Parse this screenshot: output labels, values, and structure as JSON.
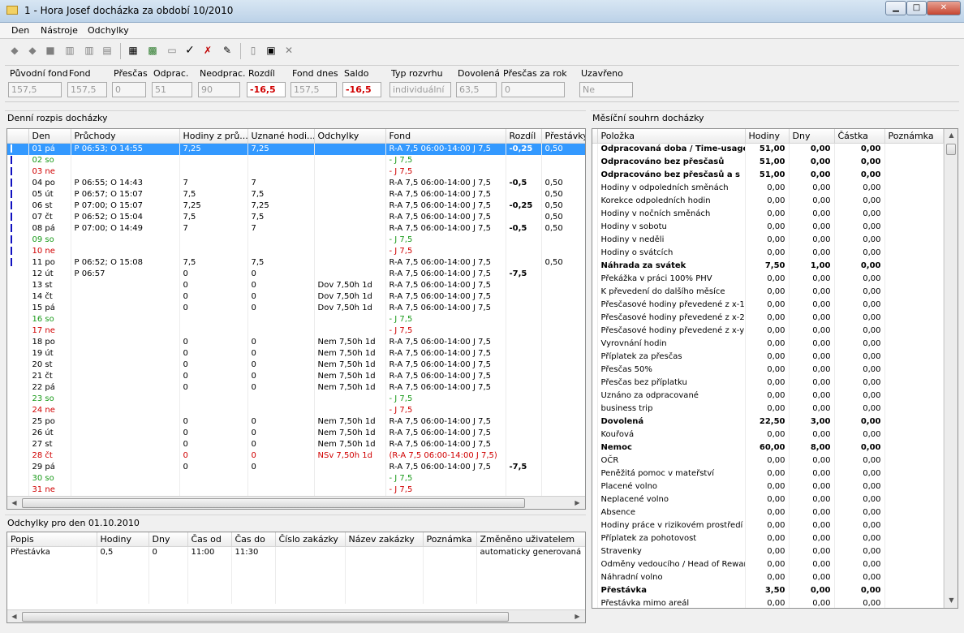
{
  "window": {
    "title": "1 - Hora Josef docházka za období 10/2010",
    "min": "▁",
    "max": "□",
    "close": "✕"
  },
  "menu": [
    "Den",
    "Nástroje",
    "Odchylky"
  ],
  "toolbar_icons": [
    "prev-record-icon",
    "next-record-icon",
    "stop-icon",
    "barcode-icon",
    "barcode-edit-icon",
    "chart-icon",
    "calculator-icon",
    "colored-grid-icon",
    "document-icon",
    "check-icon",
    "cross-check-icon",
    "sign-off-icon",
    "new-page-icon",
    "window-icon",
    "close-icon"
  ],
  "fields": [
    {
      "label": "Původní fond",
      "value": "157,5",
      "red": false
    },
    {
      "label": "Fond",
      "value": "157,5",
      "red": false
    },
    {
      "label": "Přesčas",
      "value": "0",
      "red": false
    },
    {
      "label": "Odprac.",
      "value": "51",
      "red": false
    },
    {
      "label": "Neodprac.",
      "value": "90",
      "red": false
    },
    {
      "label": "Rozdíl",
      "value": "-16,5",
      "red": true
    },
    {
      "label": "Fond dnes",
      "value": "157,5",
      "red": false
    },
    {
      "label": "Saldo",
      "value": "-16,5",
      "red": true
    },
    {
      "label": "Typ rozvrhu",
      "value": "individuální",
      "red": false
    },
    {
      "label": "Dovolená",
      "value": "63,5",
      "red": false
    },
    {
      "label": "Přesčas za rok",
      "value": "0",
      "red": false
    },
    {
      "label": "Uzavřeno",
      "value": "Ne",
      "red": false
    }
  ],
  "daily": {
    "title": "Denní rozpis docházky",
    "columns": [
      "",
      "Den",
      "Průchody",
      "Hodiny z prů...",
      "Uznané hodi...",
      "Odchylky",
      "Fond",
      "Rozdíl",
      "Přestávky"
    ],
    "rows": [
      {
        "mark": true,
        "den": "01 pá",
        "pruchody": "P 06:53; O 14:55",
        "hod": "7,25",
        "uzn": "7,25",
        "odch": "",
        "fond": "R-A  7,5  06:00-14:00 J 7,5",
        "rozdil": "-0,25",
        "prest": "0,50",
        "style": "sel"
      },
      {
        "mark": true,
        "den": "02 so",
        "pruchody": "",
        "hod": "",
        "uzn": "",
        "odch": "",
        "fond": "- J 7,5",
        "rozdil": "",
        "prest": "",
        "style": "green"
      },
      {
        "mark": true,
        "den": "03 ne",
        "pruchody": "",
        "hod": "",
        "uzn": "",
        "odch": "",
        "fond": "- J 7,5",
        "rozdil": "",
        "prest": "",
        "style": "red"
      },
      {
        "mark": true,
        "den": "04 po",
        "pruchody": "P 06:55; O 14:43",
        "hod": "7",
        "uzn": "7",
        "odch": "",
        "fond": "R-A  7,5  06:00-14:00 J 7,5",
        "rozdil": "-0,5",
        "prest": "0,50",
        "style": ""
      },
      {
        "mark": true,
        "den": "05 út",
        "pruchody": "P 06:57; O 15:07",
        "hod": "7,5",
        "uzn": "7,5",
        "odch": "",
        "fond": "R-A  7,5  06:00-14:00 J 7,5",
        "rozdil": "",
        "prest": "0,50",
        "style": ""
      },
      {
        "mark": true,
        "den": "06 st",
        "pruchody": "P 07:00; O 15:07",
        "hod": "7,25",
        "uzn": "7,25",
        "odch": "",
        "fond": "R-A  7,5  06:00-14:00 J 7,5",
        "rozdil": "-0,25",
        "prest": "0,50",
        "style": ""
      },
      {
        "mark": true,
        "den": "07 čt",
        "pruchody": "P 06:52; O 15:04",
        "hod": "7,5",
        "uzn": "7,5",
        "odch": "",
        "fond": "R-A  7,5  06:00-14:00 J 7,5",
        "rozdil": "",
        "prest": "0,50",
        "style": ""
      },
      {
        "mark": true,
        "den": "08 pá",
        "pruchody": "P 07:00; O 14:49",
        "hod": "7",
        "uzn": "7",
        "odch": "",
        "fond": "R-A  7,5  06:00-14:00 J 7,5",
        "rozdil": "-0,5",
        "prest": "0,50",
        "style": ""
      },
      {
        "mark": true,
        "den": "09 so",
        "pruchody": "",
        "hod": "",
        "uzn": "",
        "odch": "",
        "fond": "- J 7,5",
        "rozdil": "",
        "prest": "",
        "style": "green"
      },
      {
        "mark": true,
        "den": "10 ne",
        "pruchody": "",
        "hod": "",
        "uzn": "",
        "odch": "",
        "fond": "- J 7,5",
        "rozdil": "",
        "prest": "",
        "style": "red"
      },
      {
        "mark": true,
        "den": "11 po",
        "pruchody": "P 06:52; O 15:08",
        "hod": "7,5",
        "uzn": "7,5",
        "odch": "",
        "fond": "R-A  7,5  06:00-14:00 J 7,5",
        "rozdil": "",
        "prest": "0,50",
        "style": ""
      },
      {
        "mark": false,
        "den": "12 út",
        "pruchody": "P 06:57",
        "hod": "0",
        "uzn": "0",
        "odch": "",
        "fond": "R-A  7,5  06:00-14:00 J 7,5",
        "rozdil": "-7,5",
        "prest": "",
        "style": ""
      },
      {
        "mark": false,
        "den": "13 st",
        "pruchody": "",
        "hod": "0",
        "uzn": "0",
        "odch": "Dov 7,50h 1d",
        "fond": "R-A  7,5  06:00-14:00 J 7,5",
        "rozdil": "",
        "prest": "",
        "style": ""
      },
      {
        "mark": false,
        "den": "14 čt",
        "pruchody": "",
        "hod": "0",
        "uzn": "0",
        "odch": "Dov 7,50h 1d",
        "fond": "R-A  7,5  06:00-14:00 J 7,5",
        "rozdil": "",
        "prest": "",
        "style": ""
      },
      {
        "mark": false,
        "den": "15 pá",
        "pruchody": "",
        "hod": "0",
        "uzn": "0",
        "odch": "Dov 7,50h 1d",
        "fond": "R-A  7,5  06:00-14:00 J 7,5",
        "rozdil": "",
        "prest": "",
        "style": ""
      },
      {
        "mark": false,
        "den": "16 so",
        "pruchody": "",
        "hod": "",
        "uzn": "",
        "odch": "",
        "fond": "- J 7,5",
        "rozdil": "",
        "prest": "",
        "style": "green"
      },
      {
        "mark": false,
        "den": "17 ne",
        "pruchody": "",
        "hod": "",
        "uzn": "",
        "odch": "",
        "fond": "- J 7,5",
        "rozdil": "",
        "prest": "",
        "style": "red"
      },
      {
        "mark": false,
        "den": "18 po",
        "pruchody": "",
        "hod": "0",
        "uzn": "0",
        "odch": "Nem 7,50h 1d",
        "fond": "R-A  7,5  06:00-14:00 J 7,5",
        "rozdil": "",
        "prest": "",
        "style": ""
      },
      {
        "mark": false,
        "den": "19 út",
        "pruchody": "",
        "hod": "0",
        "uzn": "0",
        "odch": "Nem 7,50h 1d",
        "fond": "R-A  7,5  06:00-14:00 J 7,5",
        "rozdil": "",
        "prest": "",
        "style": ""
      },
      {
        "mark": false,
        "den": "20 st",
        "pruchody": "",
        "hod": "0",
        "uzn": "0",
        "odch": "Nem 7,50h 1d",
        "fond": "R-A  7,5  06:00-14:00 J 7,5",
        "rozdil": "",
        "prest": "",
        "style": ""
      },
      {
        "mark": false,
        "den": "21 čt",
        "pruchody": "",
        "hod": "0",
        "uzn": "0",
        "odch": "Nem 7,50h 1d",
        "fond": "R-A  7,5  06:00-14:00 J 7,5",
        "rozdil": "",
        "prest": "",
        "style": ""
      },
      {
        "mark": false,
        "den": "22 pá",
        "pruchody": "",
        "hod": "0",
        "uzn": "0",
        "odch": "Nem 7,50h 1d",
        "fond": "R-A  7,5  06:00-14:00 J 7,5",
        "rozdil": "",
        "prest": "",
        "style": ""
      },
      {
        "mark": false,
        "den": "23 so",
        "pruchody": "",
        "hod": "",
        "uzn": "",
        "odch": "",
        "fond": "- J 7,5",
        "rozdil": "",
        "prest": "",
        "style": "green"
      },
      {
        "mark": false,
        "den": "24 ne",
        "pruchody": "",
        "hod": "",
        "uzn": "",
        "odch": "",
        "fond": "- J 7,5",
        "rozdil": "",
        "prest": "",
        "style": "red"
      },
      {
        "mark": false,
        "den": "25 po",
        "pruchody": "",
        "hod": "0",
        "uzn": "0",
        "odch": "Nem 7,50h 1d",
        "fond": "R-A  7,5  06:00-14:00 J 7,5",
        "rozdil": "",
        "prest": "",
        "style": ""
      },
      {
        "mark": false,
        "den": "26 út",
        "pruchody": "",
        "hod": "0",
        "uzn": "0",
        "odch": "Nem 7,50h 1d",
        "fond": "R-A  7,5  06:00-14:00 J 7,5",
        "rozdil": "",
        "prest": "",
        "style": ""
      },
      {
        "mark": false,
        "den": "27 st",
        "pruchody": "",
        "hod": "0",
        "uzn": "0",
        "odch": "Nem 7,50h 1d",
        "fond": "R-A  7,5  06:00-14:00 J 7,5",
        "rozdil": "",
        "prest": "",
        "style": ""
      },
      {
        "mark": false,
        "den": "28 čt",
        "pruchody": "",
        "hod": "0",
        "uzn": "0",
        "odch": "NSv 7,50h 1d",
        "fond": "(R-A  7,5  06:00-14:00 J 7,5)",
        "rozdil": "",
        "prest": "",
        "style": "red"
      },
      {
        "mark": false,
        "den": "29 pá",
        "pruchody": "",
        "hod": "0",
        "uzn": "0",
        "odch": "",
        "fond": "R-A  7,5  06:00-14:00 J 7,5",
        "rozdil": "-7,5",
        "prest": "",
        "style": ""
      },
      {
        "mark": false,
        "den": "30 so",
        "pruchody": "",
        "hod": "",
        "uzn": "",
        "odch": "",
        "fond": "- J 7,5",
        "rozdil": "",
        "prest": "",
        "style": "green"
      },
      {
        "mark": false,
        "den": "31 ne",
        "pruchody": "",
        "hod": "",
        "uzn": "",
        "odch": "",
        "fond": "- J 7,5",
        "rozdil": "",
        "prest": "",
        "style": "red"
      }
    ]
  },
  "deviations": {
    "title": "Odchylky pro den 01.10.2010",
    "columns": [
      "Popis",
      "Hodiny",
      "Dny",
      "Čas od",
      "Čas do",
      "Číslo zakázky",
      "Název zakázky",
      "Poznámka",
      "Změněno uživatelem"
    ],
    "rows": [
      [
        "Přestávka",
        "0,5",
        "0",
        "11:00",
        "11:30",
        "",
        "",
        "",
        "automaticky generovaná"
      ]
    ]
  },
  "monthly": {
    "title": "Měsíční souhrn docházky",
    "columns": [
      "Položka",
      "Hodiny",
      "Dny",
      "Částka",
      "Poznámka"
    ],
    "rows": [
      {
        "name": "Odpracovaná doba / Time-usage",
        "h": "51,00",
        "d": "0,00",
        "c": "0,00",
        "bold": true
      },
      {
        "name": "Odpracováno bez přesčasů",
        "h": "51,00",
        "d": "0,00",
        "c": "0,00",
        "bold": true
      },
      {
        "name": "Odpracováno bez přesčasů a s",
        "h": "51,00",
        "d": "0,00",
        "c": "0,00",
        "bold": true
      },
      {
        "name": "Hodiny v odpoledních směnách",
        "h": "0,00",
        "d": "0,00",
        "c": "0,00",
        "bold": false
      },
      {
        "name": "Korekce odpoledních hodin",
        "h": "0,00",
        "d": "0,00",
        "c": "0,00",
        "bold": false
      },
      {
        "name": "Hodiny v nočních směnách",
        "h": "0,00",
        "d": "0,00",
        "c": "0,00",
        "bold": false
      },
      {
        "name": "Hodiny v sobotu",
        "h": "0,00",
        "d": "0,00",
        "c": "0,00",
        "bold": false
      },
      {
        "name": "Hodiny v neděli",
        "h": "0,00",
        "d": "0,00",
        "c": "0,00",
        "bold": false
      },
      {
        "name": "Hodiny o svátcích",
        "h": "0,00",
        "d": "0,00",
        "c": "0,00",
        "bold": false
      },
      {
        "name": "Náhrada za svátek",
        "h": "7,50",
        "d": "1,00",
        "c": "0,00",
        "bold": true
      },
      {
        "name": "Překážka v práci 100% PHV",
        "h": "0,00",
        "d": "0,00",
        "c": "0,00",
        "bold": false
      },
      {
        "name": "K převedení do dalšího měsíce",
        "h": "0,00",
        "d": "0,00",
        "c": "0,00",
        "bold": false
      },
      {
        "name": "Přesčasové hodiny převedené z x-1",
        "h": "0,00",
        "d": "0,00",
        "c": "0,00",
        "bold": false
      },
      {
        "name": "Přesčasové hodiny převedené z x-2",
        "h": "0,00",
        "d": "0,00",
        "c": "0,00",
        "bold": false
      },
      {
        "name": "Přesčasové hodiny převedené z x-y",
        "h": "0,00",
        "d": "0,00",
        "c": "0,00",
        "bold": false
      },
      {
        "name": "Vyrovnání hodin",
        "h": "0,00",
        "d": "0,00",
        "c": "0,00",
        "bold": false
      },
      {
        "name": "Příplatek za přesčas",
        "h": "0,00",
        "d": "0,00",
        "c": "0,00",
        "bold": false
      },
      {
        "name": "Přesčas 50%",
        "h": "0,00",
        "d": "0,00",
        "c": "0,00",
        "bold": false
      },
      {
        "name": "Přesčas bez příplatku",
        "h": "0,00",
        "d": "0,00",
        "c": "0,00",
        "bold": false
      },
      {
        "name": "Uznáno za odpracované",
        "h": "0,00",
        "d": "0,00",
        "c": "0,00",
        "bold": false
      },
      {
        "name": "business trip",
        "h": "0,00",
        "d": "0,00",
        "c": "0,00",
        "bold": false
      },
      {
        "name": "Dovolená",
        "h": "22,50",
        "d": "3,00",
        "c": "0,00",
        "bold": true
      },
      {
        "name": "Kouřová",
        "h": "0,00",
        "d": "0,00",
        "c": "0,00",
        "bold": false
      },
      {
        "name": "Nemoc",
        "h": "60,00",
        "d": "8,00",
        "c": "0,00",
        "bold": true
      },
      {
        "name": "OČR",
        "h": "0,00",
        "d": "0,00",
        "c": "0,00",
        "bold": false
      },
      {
        "name": "Peněžitá pomoc v mateřství",
        "h": "0,00",
        "d": "0,00",
        "c": "0,00",
        "bold": false
      },
      {
        "name": "Placené volno",
        "h": "0,00",
        "d": "0,00",
        "c": "0,00",
        "bold": false
      },
      {
        "name": "Neplacené volno",
        "h": "0,00",
        "d": "0,00",
        "c": "0,00",
        "bold": false
      },
      {
        "name": "Absence",
        "h": "0,00",
        "d": "0,00",
        "c": "0,00",
        "bold": false
      },
      {
        "name": "Hodiny práce v rizikovém prostředí",
        "h": "0,00",
        "d": "0,00",
        "c": "0,00",
        "bold": false
      },
      {
        "name": "Příplatek za pohotovost",
        "h": "0,00",
        "d": "0,00",
        "c": "0,00",
        "bold": false
      },
      {
        "name": "Stravenky",
        "h": "0,00",
        "d": "0,00",
        "c": "0,00",
        "bold": false
      },
      {
        "name": "Odměny vedoucího / Head of Reward",
        "h": "0,00",
        "d": "0,00",
        "c": "0,00",
        "bold": false
      },
      {
        "name": "Náhradní volno",
        "h": "0,00",
        "d": "0,00",
        "c": "0,00",
        "bold": false
      },
      {
        "name": "Přestávka",
        "h": "3,50",
        "d": "0,00",
        "c": "0,00",
        "bold": true
      },
      {
        "name": "Přestávka mimo areál",
        "h": "0,00",
        "d": "0,00",
        "c": "0,00",
        "bold": false
      }
    ]
  }
}
